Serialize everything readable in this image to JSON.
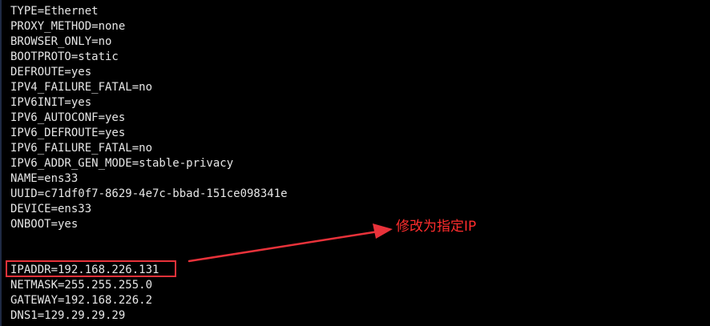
{
  "terminal": {
    "lines": [
      "TYPE=Ethernet",
      "PROXY_METHOD=none",
      "BROWSER_ONLY=no",
      "BOOTPROTO=static",
      "DEFROUTE=yes",
      "IPV4_FAILURE_FATAL=no",
      "IPV6INIT=yes",
      "IPV6_AUTOCONF=yes",
      "IPV6_DEFROUTE=yes",
      "IPV6_FAILURE_FATAL=no",
      "IPV6_ADDR_GEN_MODE=stable-privacy",
      "NAME=ens33",
      "UUID=c71df0f7-8629-4e7c-bbad-151ce098341e",
      "DEVICE=ens33",
      "ONBOOT=yes",
      "",
      "",
      "IPADDR=192.168.226.131",
      "NETMASK=255.255.255.0",
      "GATEWAY=192.168.226.2",
      "DNS1=129.29.29.29"
    ],
    "text_color": "#e6e6e6",
    "background": "#000000"
  },
  "annotation": {
    "text": "修改为指定IP",
    "color": "#ff2d2d",
    "icon": "arrow-icon"
  }
}
